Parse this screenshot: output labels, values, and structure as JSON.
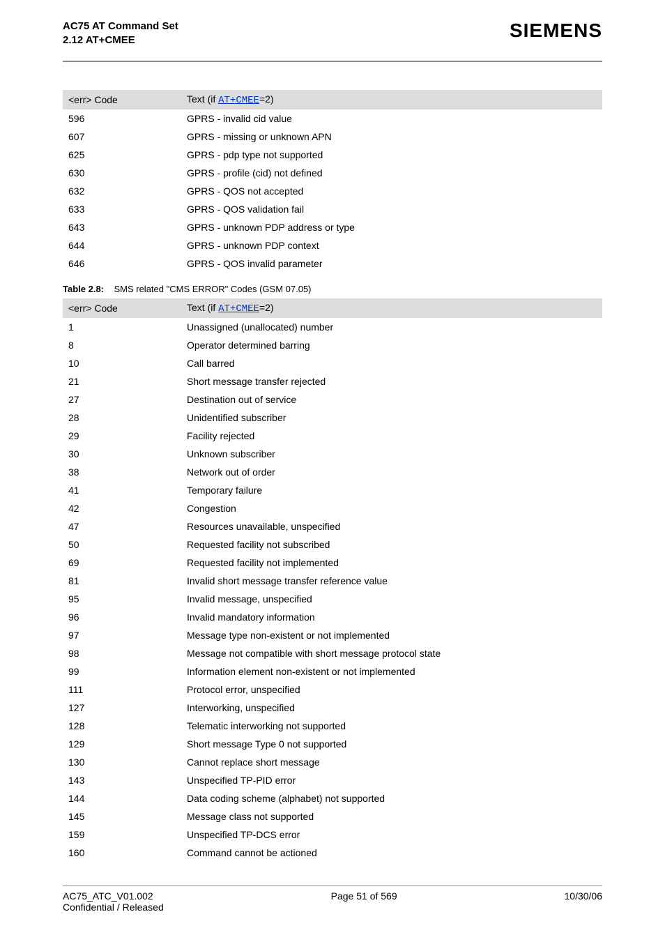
{
  "header": {
    "title_line1": "AC75 AT Command Set",
    "title_line2": "2.12 AT+CMEE",
    "brand": "SIEMENS"
  },
  "table1": {
    "header_col1": "<err> Code",
    "header_col2_prefix": "Text (if ",
    "header_col2_cmd": "AT+CMEE",
    "header_col2_suffix": "=2)",
    "rows": [
      {
        "code": "596",
        "text": "GPRS - invalid cid value"
      },
      {
        "code": "607",
        "text": "GPRS - missing or unknown APN"
      },
      {
        "code": "625",
        "text": "GPRS - pdp type not supported"
      },
      {
        "code": "630",
        "text": "GPRS - profile (cid) not defined"
      },
      {
        "code": "632",
        "text": "GPRS - QOS not accepted"
      },
      {
        "code": "633",
        "text": "GPRS - QOS validation fail"
      },
      {
        "code": "643",
        "text": "GPRS - unknown PDP address or type"
      },
      {
        "code": "644",
        "text": "GPRS - unknown PDP context"
      },
      {
        "code": "646",
        "text": "GPRS - QOS invalid parameter"
      }
    ]
  },
  "caption2": {
    "label": "Table 2.8:",
    "text": "SMS related \"CMS ERROR\" Codes (GSM 07.05)"
  },
  "table2": {
    "header_col1": "<err> Code",
    "header_col2_prefix": "Text (if ",
    "header_col2_cmd": "AT+CMEE",
    "header_col2_suffix": "=2)",
    "rows": [
      {
        "code": "1",
        "text": "Unassigned (unallocated) number"
      },
      {
        "code": "8",
        "text": "Operator determined barring"
      },
      {
        "code": "10",
        "text": "Call barred"
      },
      {
        "code": "21",
        "text": "Short message transfer rejected"
      },
      {
        "code": "27",
        "text": "Destination out of service"
      },
      {
        "code": "28",
        "text": "Unidentified subscriber"
      },
      {
        "code": "29",
        "text": "Facility rejected"
      },
      {
        "code": "30",
        "text": "Unknown subscriber"
      },
      {
        "code": "38",
        "text": "Network out of order"
      },
      {
        "code": "41",
        "text": "Temporary failure"
      },
      {
        "code": "42",
        "text": "Congestion"
      },
      {
        "code": "47",
        "text": "Resources unavailable, unspecified"
      },
      {
        "code": "50",
        "text": "Requested facility not subscribed"
      },
      {
        "code": "69",
        "text": "Requested facility not implemented"
      },
      {
        "code": "81",
        "text": "Invalid short message transfer reference value"
      },
      {
        "code": "95",
        "text": "Invalid message, unspecified"
      },
      {
        "code": "96",
        "text": "Invalid mandatory information"
      },
      {
        "code": "97",
        "text": "Message type non-existent or not implemented"
      },
      {
        "code": "98",
        "text": "Message not compatible with short message protocol state"
      },
      {
        "code": "99",
        "text": "Information element non-existent or not implemented"
      },
      {
        "code": "111",
        "text": "Protocol error, unspecified"
      },
      {
        "code": "127",
        "text": "Interworking, unspecified"
      },
      {
        "code": "128",
        "text": "Telematic interworking not supported"
      },
      {
        "code": "129",
        "text": "Short message Type 0 not supported"
      },
      {
        "code": "130",
        "text": "Cannot replace short message"
      },
      {
        "code": "143",
        "text": "Unspecified TP-PID error"
      },
      {
        "code": "144",
        "text": "Data coding scheme (alphabet) not supported"
      },
      {
        "code": "145",
        "text": "Message class not supported"
      },
      {
        "code": "159",
        "text": "Unspecified TP-DCS error"
      },
      {
        "code": "160",
        "text": "Command cannot be actioned"
      }
    ]
  },
  "footer": {
    "left_line1": "AC75_ATC_V01.002",
    "left_line2": "Confidential / Released",
    "center": "Page 51 of 569",
    "right": "10/30/06"
  }
}
